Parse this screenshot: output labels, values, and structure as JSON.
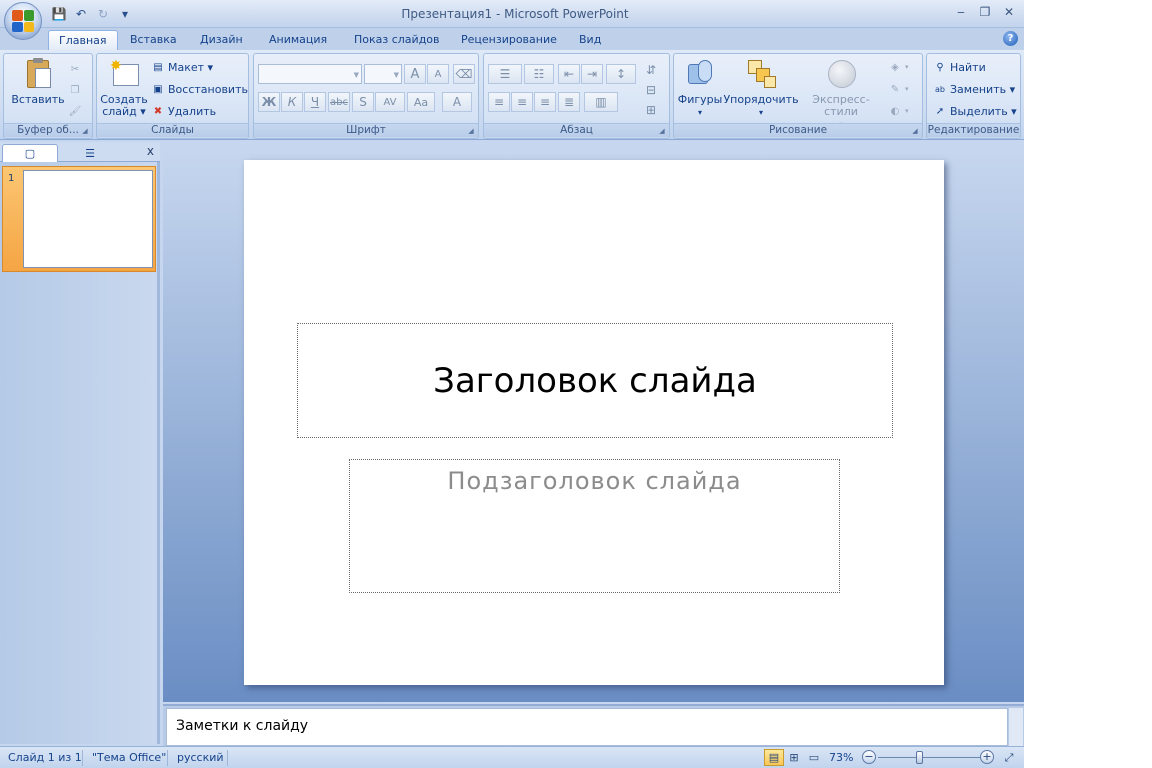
{
  "window": {
    "title": "Презентация1 - Microsoft PowerPoint",
    "minimize": "‒",
    "restore": "❐",
    "close": "✕"
  },
  "quick_access": {
    "save": "💾",
    "undo": "↶",
    "redo": "↻",
    "customize": "▾"
  },
  "tabs": [
    {
      "label": "Главная",
      "active": true
    },
    {
      "label": "Вставка"
    },
    {
      "label": "Дизайн"
    },
    {
      "label": "Анимация"
    },
    {
      "label": "Показ слайдов"
    },
    {
      "label": "Рецензирование"
    },
    {
      "label": "Вид"
    }
  ],
  "help": "?",
  "ribbon": {
    "clipboard": {
      "label": "Буфер об...",
      "paste": "Вставить"
    },
    "slides": {
      "label": "Слайды",
      "new_slide_line1": "Создать",
      "new_slide_line2": "слайд ▾",
      "layout": "Макет ▾",
      "reset": "Восстановить",
      "delete": "Удалить"
    },
    "font": {
      "label": "Шрифт",
      "bold": "Ж",
      "italic": "К",
      "underline": "Ч",
      "strike": "abc",
      "shadow": "S",
      "spacing": "AV",
      "case": "Aa",
      "color": "A",
      "grow": "A",
      "shrink": "A"
    },
    "paragraph": {
      "label": "Абзац"
    },
    "drawing": {
      "label": "Рисование",
      "shapes": "Фигуры",
      "arrange": "Упорядочить",
      "quick_styles": "Экспресс-стили"
    },
    "editing": {
      "label": "Редактирование",
      "find": "Найти",
      "replace": "Заменить ▾",
      "select": "Выделить ▾"
    }
  },
  "slide_panel": {
    "close": "x",
    "thumb_number": "1"
  },
  "slide": {
    "title": "Заголовок слайда",
    "subtitle": "Подзаголовок слайда"
  },
  "notes": {
    "text": "Заметки к слайду"
  },
  "status": {
    "slide": "Слайд 1 из 1",
    "theme": "\"Тема Office\"",
    "language": "русский",
    "zoom": "73%",
    "zoom_fraction": 0.4
  },
  "colors": {
    "ribbon_text": "#15428b",
    "thumb_highlight": "#f5a544",
    "office_logo": [
      "#e05a1c",
      "#3a9a2c",
      "#2265c9",
      "#f3b81a"
    ]
  }
}
